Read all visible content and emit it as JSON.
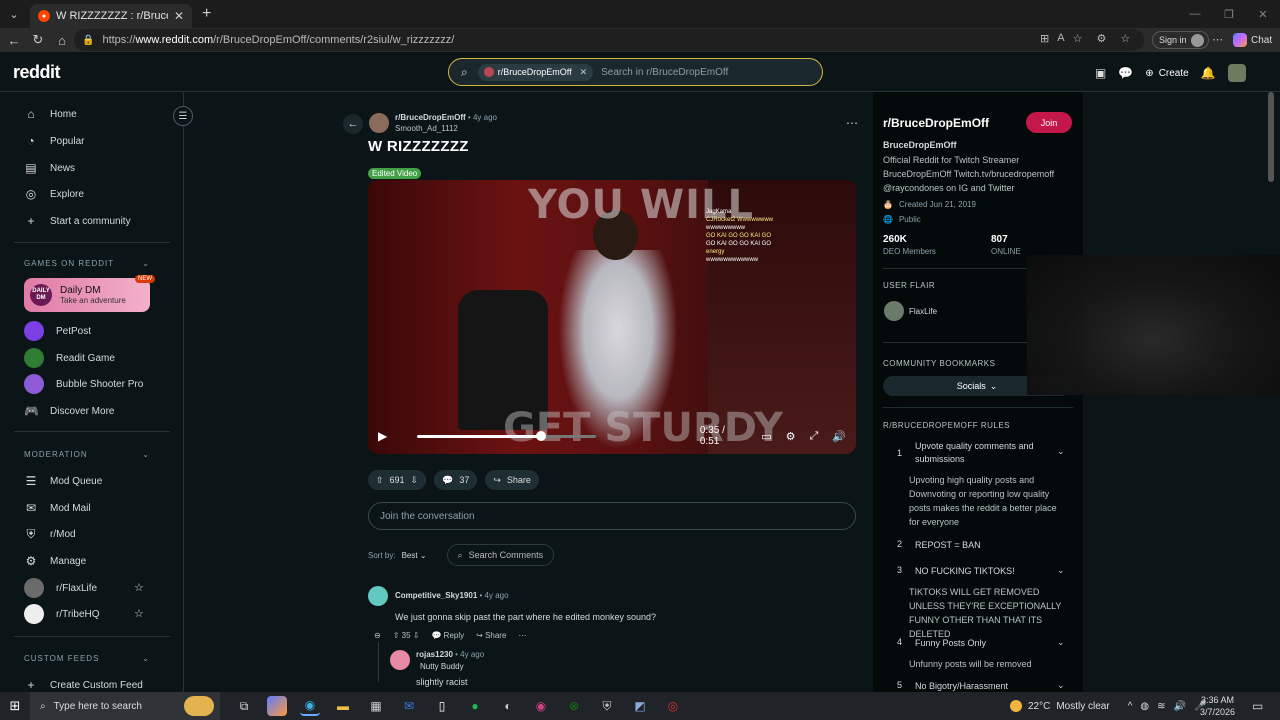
{
  "browser": {
    "tab_title": "W RIZZZZZZZ : r/BruceDropEmOff",
    "url_prefix": "https://",
    "url_host": "www.reddit.com",
    "url_path": "/r/BruceDropEmOff/comments/r2siul/w_rizzzzzzz/",
    "signin_label": "Sign in",
    "chat_label": "Chat"
  },
  "header": {
    "logo": "reddit",
    "search_chip": "r/BruceDropEmOff",
    "search_placeholder": "Search in r/BruceDropEmOff",
    "create_label": "Create"
  },
  "sidebar": {
    "nav": [
      {
        "label": "Home",
        "icon": "home-icon"
      },
      {
        "label": "Popular",
        "icon": "popular-icon"
      },
      {
        "label": "News",
        "icon": "news-icon"
      },
      {
        "label": "Explore",
        "icon": "explore-icon"
      },
      {
        "label": "Start a community",
        "icon": "plus-icon"
      }
    ],
    "games_header": "GAMES ON REDDIT",
    "daily_dm": {
      "title": "Daily DM",
      "subtitle": "Take an adventure",
      "badge": "NEW",
      "logo_text": "DAILY DM"
    },
    "games": [
      {
        "label": "PetPost",
        "color": "#7b3fe4"
      },
      {
        "label": "Readit Game",
        "color": "#2e7d32"
      },
      {
        "label": "Bubble Shooter Pro",
        "color": "#8e5bd8"
      },
      {
        "label": "Discover More",
        "color": ""
      }
    ],
    "moderation_header": "MODERATION",
    "moderation": [
      {
        "label": "Mod Queue"
      },
      {
        "label": "Mod Mail"
      },
      {
        "label": "r/Mod"
      },
      {
        "label": "Manage"
      }
    ],
    "communities": [
      {
        "label": "r/FlaxLife"
      },
      {
        "label": "r/TribeHQ"
      }
    ],
    "custom_feeds_header": "CUSTOM FEEDS",
    "create_feed": "Create Custom Feed"
  },
  "post": {
    "subreddit": "r/BruceDropEmOff",
    "age": "• 4y ago",
    "author": "Smooth_Ad_1112",
    "title": "W RIZZZZZZZ",
    "flair": "Edited Video",
    "video": {
      "overlay_top": "YOU WILL",
      "overlay_bottom": "GET STURDY",
      "time": "0:35 / 0:51",
      "progress": 0.69,
      "chat_lines": [
        "JagKama",
        "CJRocket2 Wwwwwwww",
        "wwwwwwwww",
        "GO KAI GO GO KAI GO",
        "GO KAI GO GO KAI GO",
        "energy",
        "wwwwwwwwwwww"
      ]
    },
    "votes": "691",
    "comments": "37",
    "share": "Share"
  },
  "comment_box": {
    "placeholder": "Join the conversation"
  },
  "sort": {
    "label": "Sort by:",
    "value": "Best",
    "search": "Search Comments"
  },
  "comments": [
    {
      "user": "Competitive_Sky1901",
      "age": "• 4y ago",
      "body": "We just gonna skip past the part where he edited monkey sound?",
      "votes": "35",
      "reply": "Reply",
      "share": "Share"
    },
    {
      "user": "rojas1230",
      "age": "• 4y ago",
      "flair": "Nutty Buddy",
      "body": "slightly racist"
    }
  ],
  "rsb": {
    "name": "r/BruceDropEmOff",
    "join": "Join",
    "display_name": "BruceDropEmOff",
    "description": "Official Reddit for Twitch Streamer BruceDropEmOff Twitch.tv/brucedropemoff @raycondones on IG and Twitter",
    "created": "Created Jun 21, 2019",
    "visibility": "Public",
    "members": "260K",
    "members_label": "DEO Members",
    "online": "807",
    "online_label": "ONLINE",
    "user_flair_header": "USER FLAIR",
    "user_flair": "FlaxLife",
    "bookmarks_header": "COMMUNITY BOOKMARKS",
    "socials": "Socials",
    "rules_header": "R/BRUCEDROPEMOFF RULES",
    "rules": [
      {
        "n": "1",
        "t": "Upvote quality comments and submissions",
        "d": "Upvoting high quality posts and Downvoting or reporting low quality posts makes the reddit a better place for everyone"
      },
      {
        "n": "2",
        "t": "REPOST = BAN",
        "d": ""
      },
      {
        "n": "3",
        "t": "NO FUCKING TIKTOKS!",
        "d": "TIKTOKS WILL GET REMOVED UNLESS THEY'RE EXCEPTIONALLY FUNNY OTHER THAN THAT ITS DELETED"
      },
      {
        "n": "4",
        "t": "Funny Posts Only",
        "d": "Unfunny posts will be removed"
      },
      {
        "n": "5",
        "t": "No Bigotry/Harassment",
        "d": ""
      }
    ]
  },
  "taskbar": {
    "search_placeholder": "Type here to search",
    "temp": "22°C",
    "weather": "Mostly clear",
    "time": "3:36 AM",
    "date": "3/7/2026"
  }
}
